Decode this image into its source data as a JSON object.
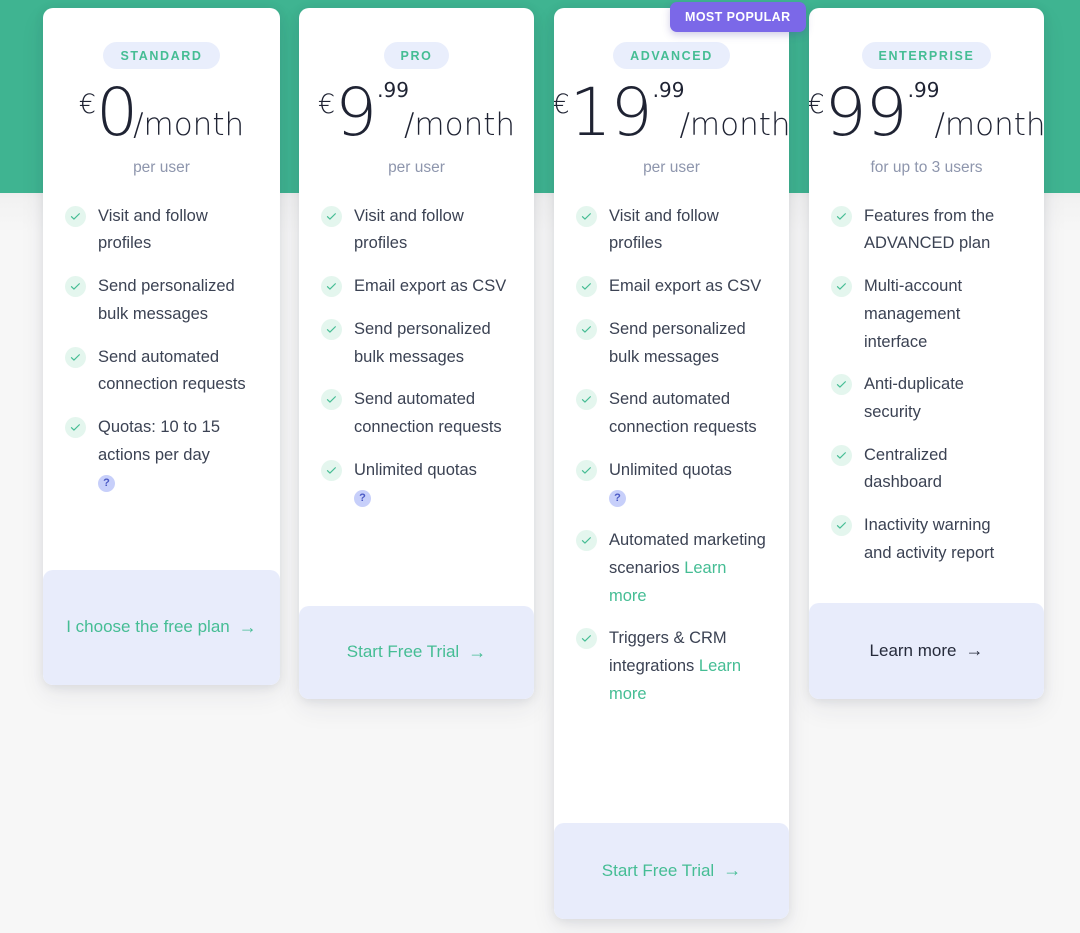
{
  "theme": {
    "band_color": "#3fb491",
    "page_bg": "#f7f7f7",
    "card_bg": "#ffffff",
    "accent_green": "#45bd94",
    "badge_purple": "#7b68e8",
    "pill_bg": "#e9eefc",
    "cta_bg": "#e8ecfb",
    "text_dark": "#3b4253",
    "text_muted": "#8e96ad"
  },
  "badges": {
    "most_popular": "MOST POPULAR"
  },
  "icons": {
    "check": "check-icon",
    "help": "?",
    "arrow": "→"
  },
  "plans": [
    {
      "id": "standard",
      "name": "STANDARD",
      "currency": "€",
      "amount": "0",
      "cents": "",
      "period": "/month",
      "note": "per user",
      "features": [
        {
          "text": "Visit and follow profiles",
          "help": false,
          "link": ""
        },
        {
          "text": "Send personalized bulk messages",
          "help": false,
          "link": ""
        },
        {
          "text": "Send automated connection requests",
          "help": false,
          "link": ""
        },
        {
          "text": "Quotas: 10 to 15 actions per day",
          "help": true,
          "link": ""
        }
      ],
      "cta_label": "I choose the free plan",
      "cta_style": "green",
      "most_popular": false
    },
    {
      "id": "pro",
      "name": "PRO",
      "currency": "€",
      "amount": "9",
      "cents": ".99",
      "period": "/month",
      "note": "per user",
      "features": [
        {
          "text": "Visit and follow profiles",
          "help": false,
          "link": ""
        },
        {
          "text": "Email export as CSV",
          "help": false,
          "link": ""
        },
        {
          "text": "Send personalized bulk messages",
          "help": false,
          "link": ""
        },
        {
          "text": "Send automated connection requests",
          "help": false,
          "link": ""
        },
        {
          "text": "Unlimited quotas",
          "help": true,
          "link": ""
        }
      ],
      "cta_label": "Start Free Trial",
      "cta_style": "green",
      "most_popular": false
    },
    {
      "id": "advanced",
      "name": "ADVANCED",
      "currency": "€",
      "amount": "19",
      "cents": ".99",
      "period": "/month",
      "note": "per user",
      "features": [
        {
          "text": "Visit and follow profiles",
          "help": false,
          "link": ""
        },
        {
          "text": "Email export as CSV",
          "help": false,
          "link": ""
        },
        {
          "text": "Send personalized bulk messages",
          "help": false,
          "link": ""
        },
        {
          "text": "Send automated connection requests",
          "help": false,
          "link": ""
        },
        {
          "text": "Unlimited quotas",
          "help": true,
          "link": ""
        },
        {
          "text": "Automated marketing scenarios ",
          "help": false,
          "link": "Learn more"
        },
        {
          "text": "Triggers & CRM integrations ",
          "help": false,
          "link": "Learn more"
        }
      ],
      "cta_label": "Start Free Trial",
      "cta_style": "green",
      "most_popular": true
    },
    {
      "id": "enterprise",
      "name": "ENTERPRISE",
      "currency": "€",
      "amount": "99",
      "cents": ".99",
      "period": "/month",
      "note": "for up to 3 users",
      "features": [
        {
          "text": "Features from the ADVANCED plan",
          "help": false,
          "link": ""
        },
        {
          "text": "Multi-account management interface",
          "help": false,
          "link": ""
        },
        {
          "text": "Anti-duplicate security",
          "help": false,
          "link": ""
        },
        {
          "text": "Centralized dashboard",
          "help": false,
          "link": ""
        },
        {
          "text": "Inactivity warning and activity report",
          "help": false,
          "link": ""
        }
      ],
      "cta_label": "Learn more",
      "cta_style": "dark",
      "most_popular": false
    }
  ]
}
